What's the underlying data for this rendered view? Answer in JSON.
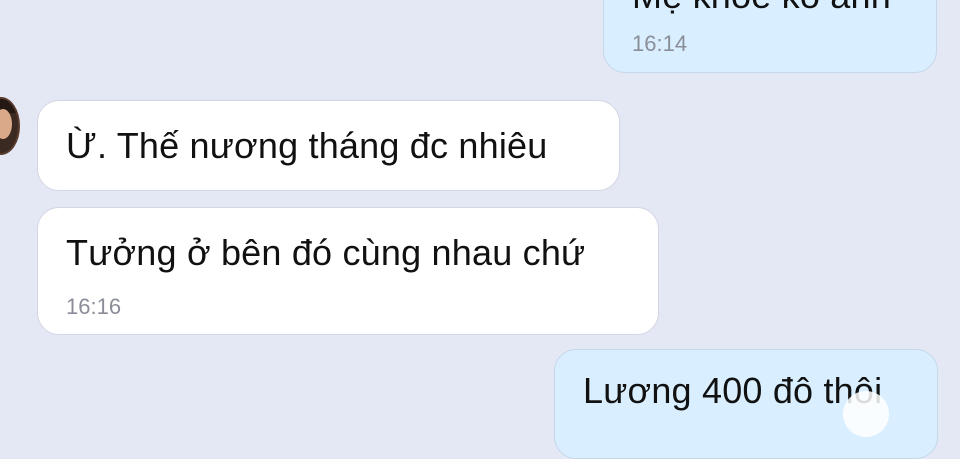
{
  "conversation": {
    "messages": [
      {
        "direction": "outgoing",
        "text": "Mẹ khoẻ ko anh",
        "time": "16:14"
      },
      {
        "direction": "incoming",
        "text": "Ừ. Thế nương tháng đc nhiêu",
        "time": ""
      },
      {
        "direction": "incoming",
        "text": "Tưởng ở bên đó cùng nhau chứ",
        "time": "16:16"
      },
      {
        "direction": "outgoing",
        "text": "Lương 400 đô thôi",
        "time": ""
      }
    ]
  },
  "colors": {
    "background": "#e4e7f4",
    "incoming_bubble": "#ffffff",
    "outgoing_bubble": "#d9efff",
    "timestamp": "#8b8e99"
  }
}
